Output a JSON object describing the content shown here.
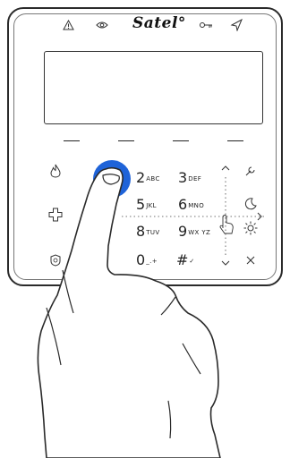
{
  "brand": "Satel°",
  "indicators": [
    "warning-icon",
    "eye-icon",
    "key-icon",
    "armed-icon"
  ],
  "keys": {
    "k2": {
      "digit": "2",
      "sub": "ABC"
    },
    "k3": {
      "digit": "3",
      "sub": "DEF"
    },
    "k5": {
      "digit": "5",
      "sub": "JKL"
    },
    "k6": {
      "digit": "6",
      "sub": "MNO"
    },
    "k8": {
      "digit": "8",
      "sub": "TUV"
    },
    "k9": {
      "digit": "9",
      "sub": "WX YZ"
    },
    "k0": {
      "digit": "0",
      "sub": "_.+"
    },
    "khash": {
      "digit": "#",
      "sub": "✓"
    }
  },
  "function_keys": [
    "fire-icon",
    "first-aid-icon",
    "panic-icon",
    "wrench-icon",
    "moon-icon",
    "sun-icon",
    "close-icon"
  ],
  "colors": {
    "touch_accent": "#1f63d8",
    "outline": "#2b2b2b"
  }
}
